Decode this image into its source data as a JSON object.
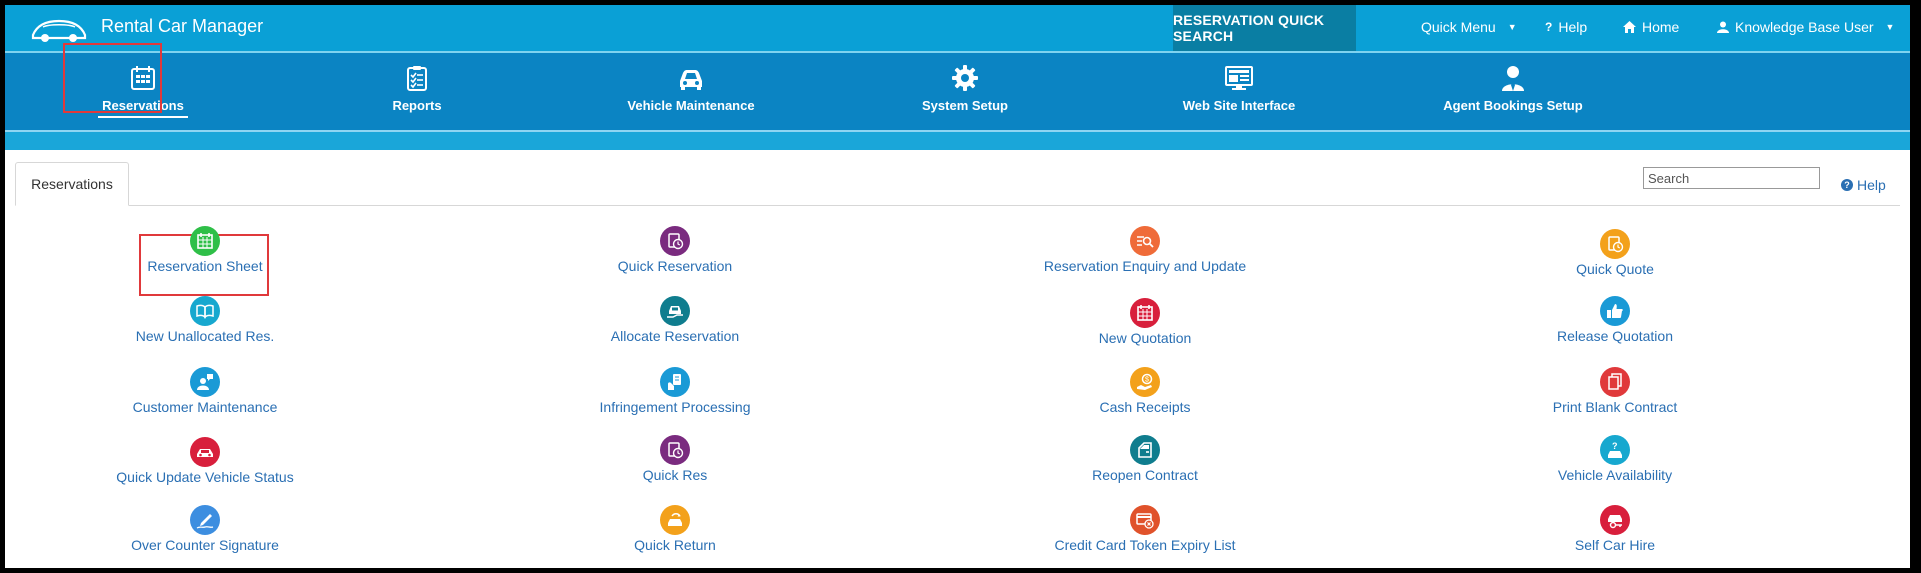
{
  "app": {
    "title": "Rental Car Manager"
  },
  "topbar": {
    "quick_search": "RESERVATION QUICK SEARCH",
    "quick_menu": "Quick Menu",
    "help": "Help",
    "home": "Home",
    "user": "Knowledge Base User"
  },
  "modules": [
    {
      "label": "Reservations",
      "icon": "calendar-icon"
    },
    {
      "label": "Reports",
      "icon": "clipboard-checklist-icon"
    },
    {
      "label": "Vehicle Maintenance",
      "icon": "car-icon"
    },
    {
      "label": "System Setup",
      "icon": "gear-icon"
    },
    {
      "label": "Web Site Interface",
      "icon": "monitor-icon"
    },
    {
      "label": "Agent Bookings Setup",
      "icon": "agent-icon"
    }
  ],
  "tabs": {
    "active": "Reservations"
  },
  "search": {
    "placeholder": "Search"
  },
  "help_link": "Help",
  "items": [
    {
      "label": "Reservation Sheet",
      "icon": "calendar-grid-icon",
      "color": "#2fbf48"
    },
    {
      "label": "Quick Reservation",
      "icon": "clipboard-clock-icon",
      "color": "#7a2b7f"
    },
    {
      "label": "Reservation Enquiry and Update",
      "icon": "search-list-icon",
      "color": "#ef6b39"
    },
    {
      "label": "Quick Quote",
      "icon": "clipboard-clock-icon",
      "color": "#f3a11b"
    },
    {
      "label": "New Unallocated Res.",
      "icon": "open-book-icon",
      "color": "#17a8cf"
    },
    {
      "label": "Allocate Reservation",
      "icon": "car-hand-icon",
      "color": "#0f7d8e"
    },
    {
      "label": "New Quotation",
      "icon": "calendar-grid-icon",
      "color": "#d81f3c"
    },
    {
      "label": "Release Quotation",
      "icon": "thumbs-up-icon",
      "color": "#1a9ad6"
    },
    {
      "label": "Customer Maintenance",
      "icon": "person-chat-icon",
      "color": "#1a9ad6"
    },
    {
      "label": "Infringement Processing",
      "icon": "hand-document-icon",
      "color": "#1a9ad6"
    },
    {
      "label": "Cash Receipts",
      "icon": "money-hand-icon",
      "color": "#f3a11b"
    },
    {
      "label": "Print Blank Contract",
      "icon": "document-copy-icon",
      "color": "#e0393b"
    },
    {
      "label": "Quick Update Vehicle Status",
      "icon": "car-icon",
      "color": "#d81f3c"
    },
    {
      "label": "Quick Res",
      "icon": "clipboard-clock-icon",
      "color": "#7a2b7f"
    },
    {
      "label": "Reopen Contract",
      "icon": "car-door-icon",
      "color": "#0f7d8e"
    },
    {
      "label": "Vehicle Availability",
      "icon": "car-question-icon",
      "color": "#17a8cf"
    },
    {
      "label": "Over Counter Signature",
      "icon": "pen-signature-icon",
      "color": "#3d8ee0"
    },
    {
      "label": "Quick Return",
      "icon": "car-return-icon",
      "color": "#f3a11b"
    },
    {
      "label": "Credit Card Token Expiry List",
      "icon": "card-cancel-icon",
      "color": "#e0522b"
    },
    {
      "label": "Self Car Hire",
      "icon": "car-key-icon",
      "color": "#d81f3c"
    }
  ]
}
